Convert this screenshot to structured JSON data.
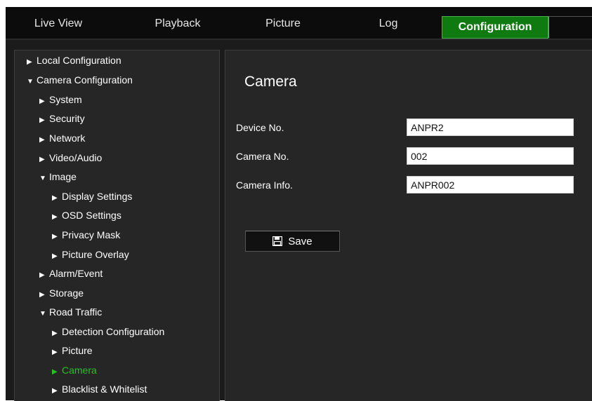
{
  "nav": {
    "tabs": [
      {
        "label": "Live View"
      },
      {
        "label": "Playback"
      },
      {
        "label": "Picture"
      },
      {
        "label": "Log"
      },
      {
        "label": "Configuration"
      }
    ],
    "active_tab": "Configuration"
  },
  "sidebar": {
    "items": [
      {
        "label": "Local Configuration",
        "expanded": false
      },
      {
        "label": "Camera Configuration",
        "expanded": true
      },
      {
        "label": "System",
        "expanded": false
      },
      {
        "label": "Security",
        "expanded": false
      },
      {
        "label": "Network",
        "expanded": false
      },
      {
        "label": "Video/Audio",
        "expanded": false
      },
      {
        "label": "Image",
        "expanded": true
      },
      {
        "label": "Display Settings",
        "expanded": false
      },
      {
        "label": "OSD Settings",
        "expanded": false
      },
      {
        "label": "Privacy Mask",
        "expanded": false
      },
      {
        "label": "Picture Overlay",
        "expanded": false
      },
      {
        "label": "Alarm/Event",
        "expanded": false
      },
      {
        "label": "Storage",
        "expanded": false
      },
      {
        "label": "Road Traffic",
        "expanded": true
      },
      {
        "label": "Detection Configuration",
        "expanded": false
      },
      {
        "label": "Picture",
        "expanded": false
      },
      {
        "label": "Camera",
        "expanded": false,
        "active": true
      },
      {
        "label": "Blacklist & Whitelist",
        "expanded": false
      }
    ]
  },
  "main": {
    "title": "Camera",
    "fields": {
      "device_no": {
        "label": "Device No.",
        "value": "ANPR2"
      },
      "camera_no": {
        "label": "Camera No.",
        "value": "002"
      },
      "camera_info": {
        "label": "Camera Info.",
        "value": "ANPR002"
      }
    },
    "save_label": "Save"
  },
  "colors": {
    "accent": "#0f7a0f",
    "active_menu_text": "#27c227",
    "panel_bg": "#262626",
    "app_bg": "#1b1b1b"
  },
  "icons": {
    "collapsed": "triangle-right-icon",
    "expanded": "triangle-down-icon",
    "save": "floppy-disk-icon"
  }
}
